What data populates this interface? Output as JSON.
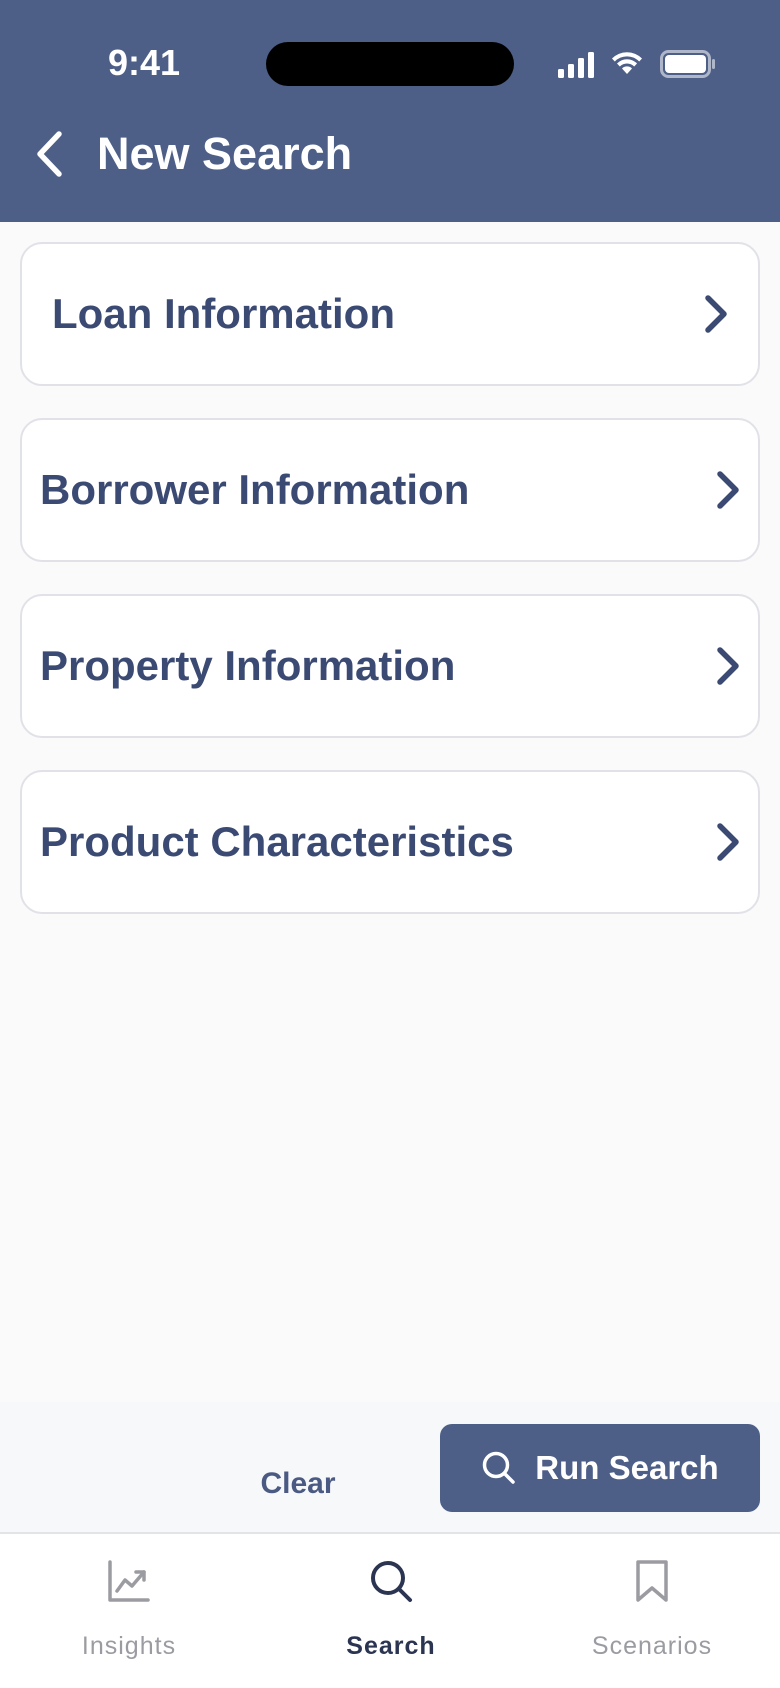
{
  "status_bar": {
    "time": "9:41"
  },
  "header": {
    "title": "New Search"
  },
  "sections": [
    {
      "label": "Loan Information"
    },
    {
      "label": "Borrower Information"
    },
    {
      "label": "Property Information"
    },
    {
      "label": "Product Characteristics"
    }
  ],
  "actions": {
    "clear_label": "Clear",
    "run_label": "Run Search"
  },
  "tabbar": {
    "tabs": [
      {
        "label": "Insights",
        "icon": "chart-icon",
        "active": false
      },
      {
        "label": "Search",
        "icon": "search-icon",
        "active": true
      },
      {
        "label": "Scenarios",
        "icon": "bookmark-icon",
        "active": false
      }
    ]
  },
  "colors": {
    "header_bg": "#4d5e87",
    "card_text": "#3b4a73",
    "page_bg": "#fafafb",
    "active_tab": "#2b3552",
    "inactive_tab": "#9b9ca2"
  }
}
